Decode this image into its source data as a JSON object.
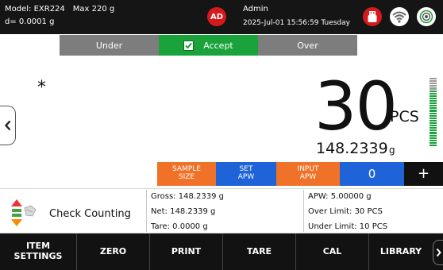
{
  "header": {
    "model": "Model: EXR224",
    "max": "Max 220 g",
    "readability": "d= 0.0001 g",
    "avatar_initials": "AD",
    "user": "Admin",
    "datetime": "2025-Jul-01 15:56:59 Tuesday",
    "icons": [
      "usb-icon",
      "wifi-icon",
      "target-icon"
    ],
    "colors": {
      "avatar": "#d6191c",
      "usb": "#d6191c"
    }
  },
  "status": {
    "under": "Under",
    "accept": "Accept",
    "over": "Over",
    "active": "accept",
    "colors": {
      "inactive": "#7d7d7d",
      "accept": "#1aa33a"
    }
  },
  "display": {
    "stable_mark": "*",
    "count": "30",
    "count_unit": "PCS",
    "weight": "148.2339",
    "weight_unit": "g",
    "bar_meter_fill": 0.82,
    "colors": {
      "bar_filled": "#1aa33a",
      "bar_empty": "#9a9a9a"
    }
  },
  "params": {
    "sample_size_line1": "SAMPLE",
    "sample_size_line2": "SIZE",
    "set_apw_line1": "SET",
    "set_apw_line2": "APW",
    "input_apw_line1": "INPUT",
    "input_apw_line2": "APW",
    "apw_input_value": "0",
    "plus": "+",
    "colors": {
      "orange": "#f07228",
      "blue": "#1e63d8"
    }
  },
  "info": {
    "mode": "Check Counting",
    "gross": "Gross: 148.2339 g",
    "net": "Net: 148.2339 g",
    "tare": "Tare: 0.0000 g",
    "apw": "APW: 5.00000 g",
    "over_limit": "Over Limit: 30 PCS",
    "under_limit": "Under Limit: 10 PCS"
  },
  "nav": {
    "item_settings_line1": "ITEM",
    "item_settings_line2": "SETTINGS",
    "zero": "ZERO",
    "print": "PRINT",
    "tare": "TARE",
    "cal": "CAL",
    "library": "LIBRARY"
  }
}
